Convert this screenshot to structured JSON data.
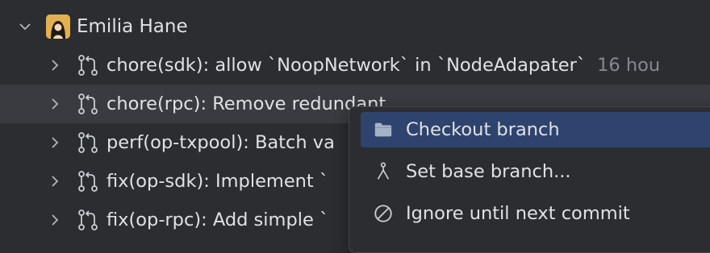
{
  "author": {
    "name": "Emilia Hane",
    "expanded": true
  },
  "pull_requests": [
    {
      "title": "chore(sdk): allow `NoopNetwork` in `NodeAdapater`",
      "time": "16 hou"
    },
    {
      "title": "chore(rpc): Remove redundant",
      "time": ""
    },
    {
      "title": "perf(op-txpool): Batch va",
      "time": ""
    },
    {
      "title": "fix(op-sdk): Implement `",
      "time": ""
    },
    {
      "title": "fix(op-rpc): Add simple `",
      "time": ""
    }
  ],
  "context_menu": {
    "items": [
      {
        "label": "Checkout branch",
        "icon": "folder-icon",
        "selected": true
      },
      {
        "label": "Set base branch...",
        "icon": "branch-merge-icon",
        "selected": false
      },
      {
        "label": "Ignore until next commit",
        "icon": "ignore-icon",
        "selected": false
      }
    ]
  },
  "colors": {
    "background": "#2b2d30",
    "hover_row": "#393b40",
    "selected_menu_item": "#2e436e",
    "secondary_text": "#868991"
  }
}
